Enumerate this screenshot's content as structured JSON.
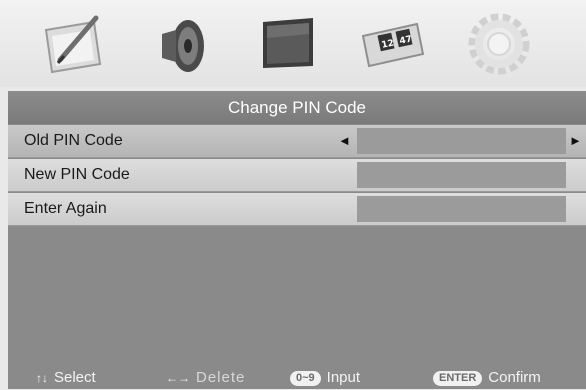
{
  "tabs": [
    {
      "id": "picture",
      "icon": "picture-pen-icon"
    },
    {
      "id": "sound",
      "icon": "speaker-icon"
    },
    {
      "id": "screen",
      "icon": "monitor-icon"
    },
    {
      "id": "time",
      "icon": "clock-icon"
    },
    {
      "id": "setup",
      "icon": "gear-icon"
    }
  ],
  "menu": {
    "title": "Change PIN Code",
    "rows": [
      {
        "label": "Old PIN Code",
        "value": "",
        "selected": true
      },
      {
        "label": "New PIN Code",
        "value": ""
      },
      {
        "label": "Enter Again",
        "value": ""
      }
    ],
    "arrow_left": "◄",
    "arrow_right": "►"
  },
  "help": {
    "select": {
      "keys": "↑↓",
      "label": "Select"
    },
    "delete": {
      "keys": "←→",
      "label": "Delete"
    },
    "input": {
      "pill": "0~9",
      "label": "Input"
    },
    "confirm": {
      "pill": "ENTER",
      "label": "Confirm"
    }
  }
}
